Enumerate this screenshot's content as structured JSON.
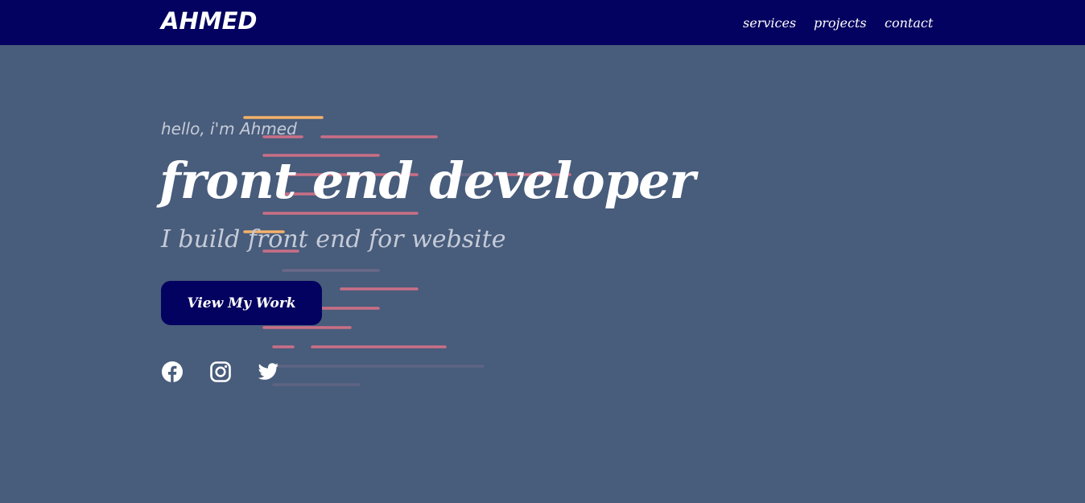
{
  "nav": {
    "brand": "AHMED",
    "links": [
      "services",
      "projects",
      "contact"
    ]
  },
  "hero": {
    "greeting": "hello, i'm Ahmed",
    "title": "front end developer",
    "subtitle": "I build front end for website",
    "cta_label": "View My Work"
  },
  "social": {
    "icons": [
      "facebook-icon",
      "instagram-icon",
      "twitter-icon"
    ]
  },
  "colors": {
    "navbar": "#040260",
    "background": "#485c7b",
    "accent_orange": "#f4b26a",
    "accent_pink": "#c96f86",
    "accent_faint": "#5e6483"
  }
}
